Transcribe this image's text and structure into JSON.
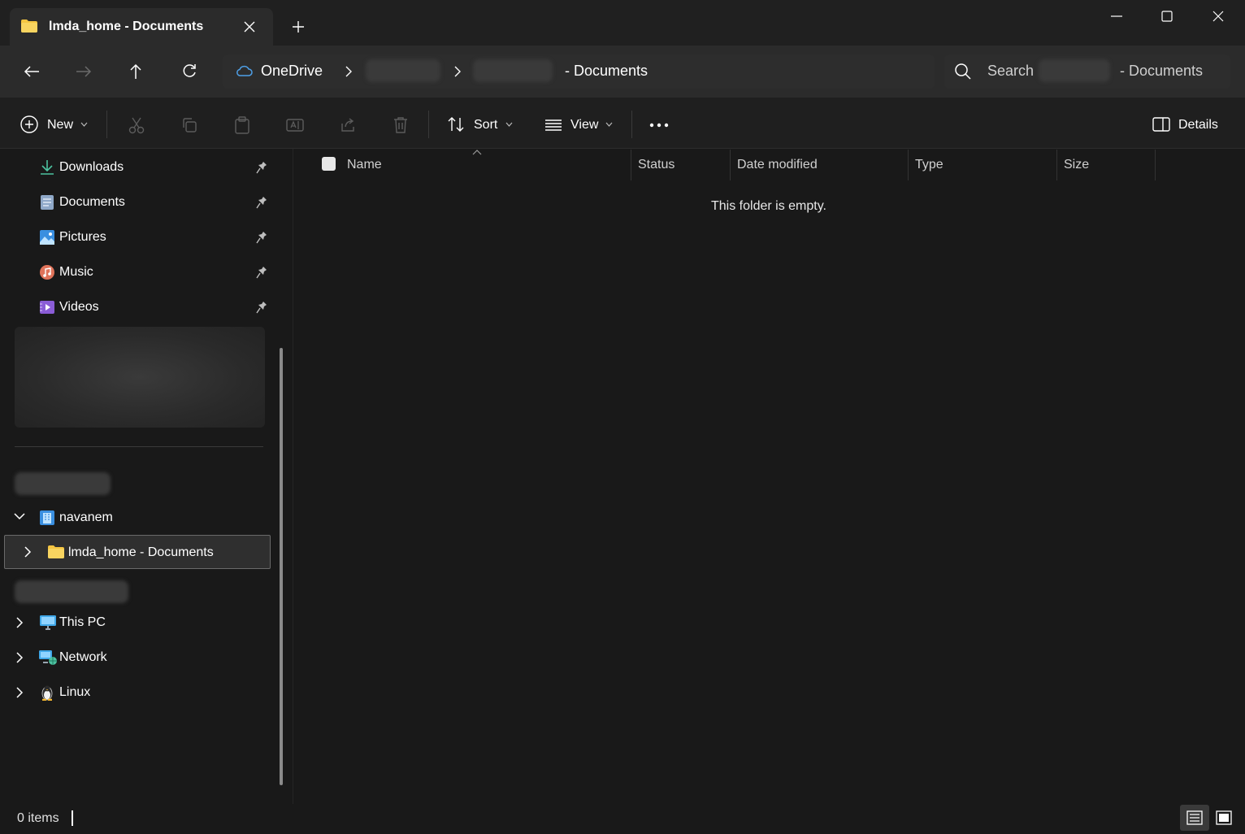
{
  "window": {
    "tab_title": "lmda_home - Documents",
    "new_tab_symbol": "+"
  },
  "address": {
    "root": "OneDrive",
    "current": "- Documents"
  },
  "search": {
    "label": "Search",
    "suffix": "- Documents"
  },
  "commandbar": {
    "new_label": "New",
    "sort_label": "Sort",
    "view_label": "View",
    "details_label": "Details"
  },
  "nav": {
    "quick_access": [
      {
        "label": "Downloads",
        "icon": "download-icon"
      },
      {
        "label": "Documents",
        "icon": "documents-icon"
      },
      {
        "label": "Pictures",
        "icon": "pictures-icon"
      },
      {
        "label": "Music",
        "icon": "music-icon"
      },
      {
        "label": "Videos",
        "icon": "videos-icon"
      }
    ],
    "tree": {
      "user_label": "navanem",
      "selected_folder": "lmda_home - Documents",
      "this_pc": "This PC",
      "network": "Network",
      "linux": "Linux"
    }
  },
  "content": {
    "columns": [
      "Name",
      "Status",
      "Date modified",
      "Type",
      "Size"
    ],
    "empty_message": "This folder is empty."
  },
  "statusbar": {
    "items_text": "0 items"
  },
  "colors": {
    "folder": "#f4c542",
    "accent_blue": "#4ea0e8",
    "background": "#191919"
  }
}
